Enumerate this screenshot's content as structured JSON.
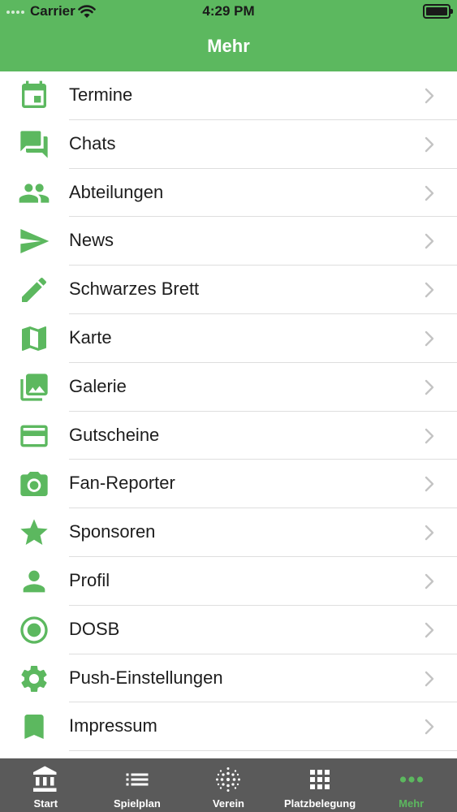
{
  "status_bar": {
    "carrier": "Carrier",
    "time": "4:29 PM"
  },
  "header": {
    "title": "Mehr"
  },
  "menu": [
    {
      "label": "Termine",
      "icon": "calendar-icon"
    },
    {
      "label": "Chats",
      "icon": "chat-icon"
    },
    {
      "label": "Abteilungen",
      "icon": "group-icon"
    },
    {
      "label": "News",
      "icon": "send-icon"
    },
    {
      "label": "Schwarzes Brett",
      "icon": "pencil-icon"
    },
    {
      "label": "Karte",
      "icon": "map-icon"
    },
    {
      "label": "Galerie",
      "icon": "gallery-icon"
    },
    {
      "label": "Gutscheine",
      "icon": "card-icon"
    },
    {
      "label": "Fan-Reporter",
      "icon": "camera-icon"
    },
    {
      "label": "Sponsoren",
      "icon": "star-icon"
    },
    {
      "label": "Profil",
      "icon": "person-icon"
    },
    {
      "label": "DOSB",
      "icon": "target-icon"
    },
    {
      "label": "Push-Einstellungen",
      "icon": "gear-icon"
    },
    {
      "label": "Impressum",
      "icon": "bookmark-icon"
    }
  ],
  "tabs": [
    {
      "label": "Start",
      "icon": "bank-icon",
      "active": false
    },
    {
      "label": "Spielplan",
      "icon": "list-icon",
      "active": false
    },
    {
      "label": "Verein",
      "icon": "dots-globe-icon",
      "active": false
    },
    {
      "label": "Platzbelegung",
      "icon": "grid-icon",
      "active": false
    },
    {
      "label": "Mehr",
      "icon": "more-icon",
      "active": true
    }
  ],
  "colors": {
    "accent": "#5cb85f",
    "tabbar": "#5a5a5a",
    "text": "#1d1d1d"
  }
}
